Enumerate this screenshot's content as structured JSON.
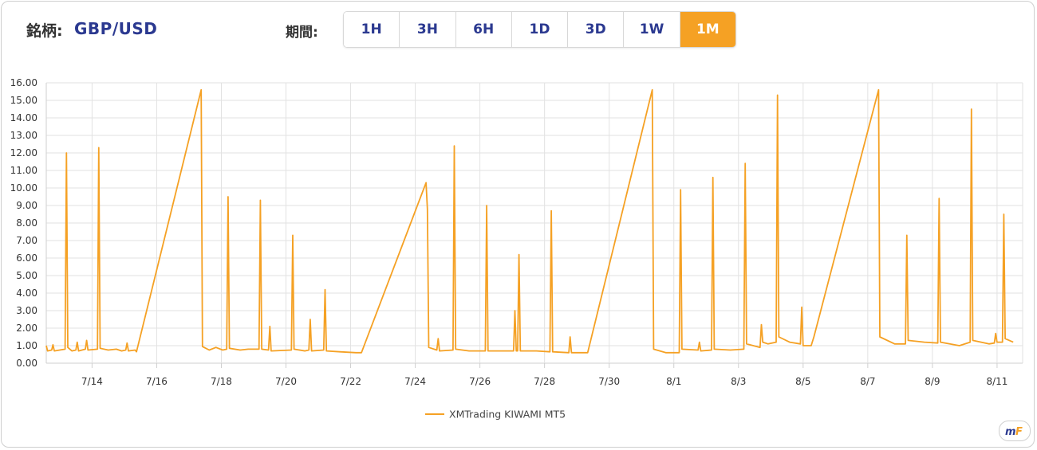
{
  "header": {
    "symbol_label": "銘柄:",
    "symbol_value": "GBP/USD",
    "period_label": "期間:",
    "periods": [
      "1H",
      "3H",
      "6H",
      "1D",
      "3D",
      "1W",
      "1M"
    ],
    "active_period": "1M"
  },
  "colors": {
    "accent": "#f5a124",
    "text_blue": "#2b3990",
    "grid": "#e2e2e2"
  },
  "chart_data": {
    "type": "line",
    "ylim": [
      0,
      16
    ],
    "yticks": [
      "0.00",
      "1.00",
      "2.00",
      "3.00",
      "4.00",
      "5.00",
      "6.00",
      "7.00",
      "8.00",
      "9.00",
      "10.00",
      "11.00",
      "12.00",
      "13.00",
      "14.00",
      "15.00",
      "16.00"
    ],
    "xlim": [
      "7/12 14:00",
      "7/11+31d"
    ],
    "xtick_labels": [
      "7/14",
      "7/16",
      "7/18",
      "7/20",
      "7/22",
      "7/24",
      "7/26",
      "7/28",
      "7/30",
      "8/1",
      "8/3",
      "8/5",
      "8/7",
      "8/9",
      "8/11"
    ],
    "series": [
      {
        "name": "XMTrading KIWAMI MT5",
        "color": "#f5a124",
        "points": [
          [
            "7/12 14:00",
            1.0
          ],
          [
            "7/12 15:00",
            0.7
          ],
          [
            "7/12 18:00",
            0.75
          ],
          [
            "7/12 19:00",
            1.05
          ],
          [
            "7/12 20:00",
            0.7
          ],
          [
            "7/13 04:00",
            0.8
          ],
          [
            "7/13 05:00",
            12.0
          ],
          [
            "7/13 06:00",
            0.9
          ],
          [
            "7/13 09:00",
            0.7
          ],
          [
            "7/13 12:00",
            0.75
          ],
          [
            "7/13 13:00",
            1.2
          ],
          [
            "7/13 14:00",
            0.7
          ],
          [
            "7/13 19:00",
            0.8
          ],
          [
            "7/13 20:00",
            1.3
          ],
          [
            "7/13 21:00",
            0.75
          ],
          [
            "7/14 04:00",
            0.8
          ],
          [
            "7/14 05:00",
            12.3
          ],
          [
            "7/14 06:00",
            0.85
          ],
          [
            "7/14 12:00",
            0.75
          ],
          [
            "7/14 18:00",
            0.8
          ],
          [
            "7/14 22:00",
            0.7
          ],
          [
            "7/15 01:00",
            0.75
          ],
          [
            "7/15 02:00",
            1.15
          ],
          [
            "7/15 03:00",
            0.7
          ],
          [
            "7/15 08:00",
            0.75
          ],
          [
            "7/15 09:00",
            0.65
          ],
          [
            "7/17 09:00",
            15.6
          ],
          [
            "7/17 10:00",
            0.95
          ],
          [
            "7/17 15:00",
            0.75
          ],
          [
            "7/17 20:00",
            0.9
          ],
          [
            "7/18 01:00",
            0.75
          ],
          [
            "7/18 04:00",
            0.8
          ],
          [
            "7/18 05:00",
            9.5
          ],
          [
            "7/18 06:00",
            0.85
          ],
          [
            "7/18 14:00",
            0.75
          ],
          [
            "7/18 20:00",
            0.8
          ],
          [
            "7/19 04:00",
            0.8
          ],
          [
            "7/19 05:00",
            9.3
          ],
          [
            "7/19 06:00",
            0.8
          ],
          [
            "7/19 11:00",
            0.75
          ],
          [
            "7/19 12:00",
            2.1
          ],
          [
            "7/19 13:00",
            0.7
          ],
          [
            "7/20 04:00",
            0.75
          ],
          [
            "7/20 05:00",
            7.3
          ],
          [
            "7/20 06:00",
            0.8
          ],
          [
            "7/20 14:00",
            0.7
          ],
          [
            "7/20 17:00",
            0.75
          ],
          [
            "7/20 18:00",
            2.5
          ],
          [
            "7/20 19:00",
            0.7
          ],
          [
            "7/21 04:00",
            0.75
          ],
          [
            "7/21 05:00",
            4.2
          ],
          [
            "7/21 06:00",
            0.7
          ],
          [
            "7/21 16:00",
            0.65
          ],
          [
            "7/22 04:00",
            0.6
          ],
          [
            "7/22 08:00",
            0.6
          ],
          [
            "7/24 08:00",
            10.3
          ],
          [
            "7/24 09:00",
            8.8
          ],
          [
            "7/24 10:00",
            0.9
          ],
          [
            "7/24 16:00",
            0.75
          ],
          [
            "7/24 17:00",
            1.4
          ],
          [
            "7/24 18:00",
            0.7
          ],
          [
            "7/25 04:00",
            0.75
          ],
          [
            "7/25 05:00",
            12.4
          ],
          [
            "7/25 06:00",
            0.8
          ],
          [
            "7/25 16:00",
            0.7
          ],
          [
            "7/26 04:00",
            0.7
          ],
          [
            "7/26 05:00",
            9.0
          ],
          [
            "7/26 06:00",
            0.7
          ],
          [
            "7/26 20:00",
            0.7
          ],
          [
            "7/27 01:00",
            0.7
          ],
          [
            "7/27 02:00",
            3.0
          ],
          [
            "7/27 03:00",
            0.7
          ],
          [
            "7/27 04:00",
            0.7
          ],
          [
            "7/27 05:00",
            6.2
          ],
          [
            "7/27 06:00",
            0.7
          ],
          [
            "7/27 18:00",
            0.7
          ],
          [
            "7/28 04:00",
            0.65
          ],
          [
            "7/28 05:00",
            8.7
          ],
          [
            "7/28 06:00",
            0.65
          ],
          [
            "7/28 18:00",
            0.6
          ],
          [
            "7/28 19:00",
            1.5
          ],
          [
            "7/28 20:00",
            0.6
          ],
          [
            "7/29 03:00",
            0.6
          ],
          [
            "7/29 08:00",
            0.6
          ],
          [
            "7/31 08:00",
            15.6
          ],
          [
            "7/31 09:00",
            0.8
          ],
          [
            "7/31 18:00",
            0.6
          ],
          [
            "8/1 04:00",
            0.6
          ],
          [
            "8/1 05:00",
            9.9
          ],
          [
            "8/1 06:00",
            0.8
          ],
          [
            "8/1 18:00",
            0.75
          ],
          [
            "8/1 19:00",
            1.2
          ],
          [
            "8/1 20:00",
            0.7
          ],
          [
            "8/2 04:00",
            0.75
          ],
          [
            "8/2 05:00",
            10.6
          ],
          [
            "8/2 06:00",
            0.8
          ],
          [
            "8/2 18:00",
            0.75
          ],
          [
            "8/3 04:00",
            0.8
          ],
          [
            "8/3 05:00",
            11.4
          ],
          [
            "8/3 06:00",
            1.1
          ],
          [
            "8/3 16:00",
            0.9
          ],
          [
            "8/3 17:00",
            2.2
          ],
          [
            "8/3 18:00",
            1.2
          ],
          [
            "8/3 22:00",
            1.1
          ],
          [
            "8/4 04:00",
            1.2
          ],
          [
            "8/4 05:00",
            15.3
          ],
          [
            "8/4 06:00",
            1.5
          ],
          [
            "8/4 14:00",
            1.2
          ],
          [
            "8/4 22:00",
            1.1
          ],
          [
            "8/4 23:00",
            3.2
          ],
          [
            "8/5 00:00",
            1.0
          ],
          [
            "8/5 06:00",
            1.0
          ],
          [
            "8/5 08:00",
            1.5
          ],
          [
            "8/7 08:00",
            15.6
          ],
          [
            "8/7 09:00",
            1.5
          ],
          [
            "8/7 20:00",
            1.1
          ],
          [
            "8/8 04:00",
            1.1
          ],
          [
            "8/8 05:00",
            7.3
          ],
          [
            "8/8 06:00",
            1.3
          ],
          [
            "8/8 18:00",
            1.2
          ],
          [
            "8/9 04:00",
            1.15
          ],
          [
            "8/9 05:00",
            9.4
          ],
          [
            "8/9 06:00",
            1.2
          ],
          [
            "8/9 20:00",
            1.0
          ],
          [
            "8/10 04:00",
            1.2
          ],
          [
            "8/10 05:00",
            14.5
          ],
          [
            "8/10 06:00",
            1.3
          ],
          [
            "8/10 18:00",
            1.1
          ],
          [
            "8/10 22:00",
            1.15
          ],
          [
            "8/10 23:00",
            1.7
          ],
          [
            "8/11 00:00",
            1.2
          ],
          [
            "8/11 04:00",
            1.2
          ],
          [
            "8/11 05:00",
            8.5
          ],
          [
            "8/11 06:00",
            1.4
          ],
          [
            "8/11 12:00",
            1.2
          ]
        ]
      }
    ],
    "legend_position": "bottom-center",
    "grid": true
  },
  "branding": {
    "logo_text": "mF",
    "logo_icon": "myforex-logo"
  }
}
